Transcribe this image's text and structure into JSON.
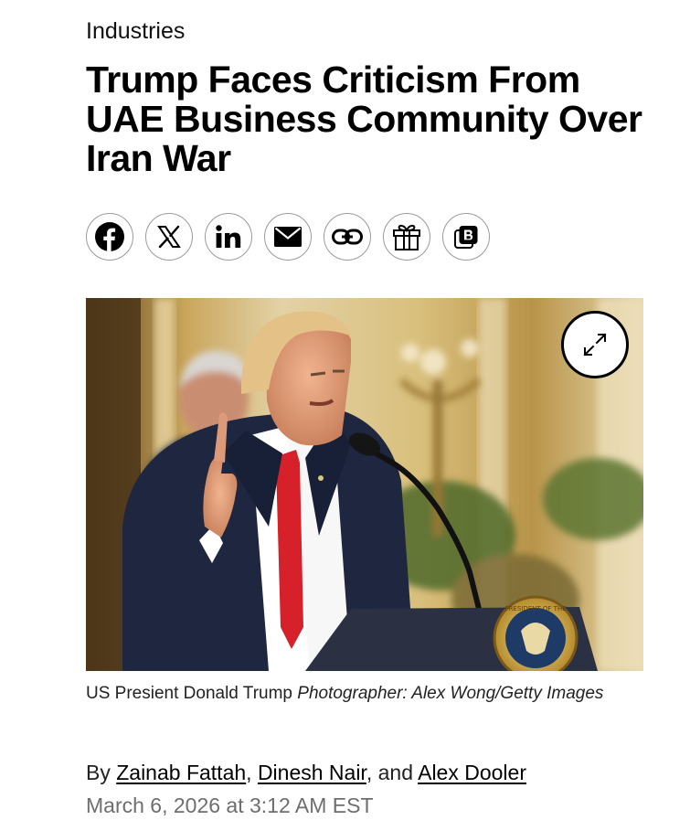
{
  "article": {
    "category": "Industries",
    "headline": "Trump Faces Criticism From UAE Business Community Over Iran War",
    "caption": {
      "text": "US Presient Donald Trump",
      "credit": "Photographer: Alex Wong/Getty Images"
    },
    "byline": {
      "prefix": "By",
      "authors": [
        "Zainab Fattah",
        "Dinesh Nair",
        "Alex Dooler"
      ],
      "sep1": ",",
      "sep2": ", and"
    },
    "timestamp": "March 6, 2026 at 3:12 AM EST"
  },
  "share": {
    "items": [
      {
        "icon": "facebook-icon"
      },
      {
        "icon": "x-icon"
      },
      {
        "icon": "linkedin-icon"
      },
      {
        "icon": "email-icon"
      },
      {
        "icon": "link-icon"
      },
      {
        "icon": "gift-icon"
      },
      {
        "icon": "bookmark-icon"
      }
    ]
  },
  "photo": {
    "expand_icon": "expand-icon",
    "seal_text": "PRESIDENT OF THE"
  }
}
